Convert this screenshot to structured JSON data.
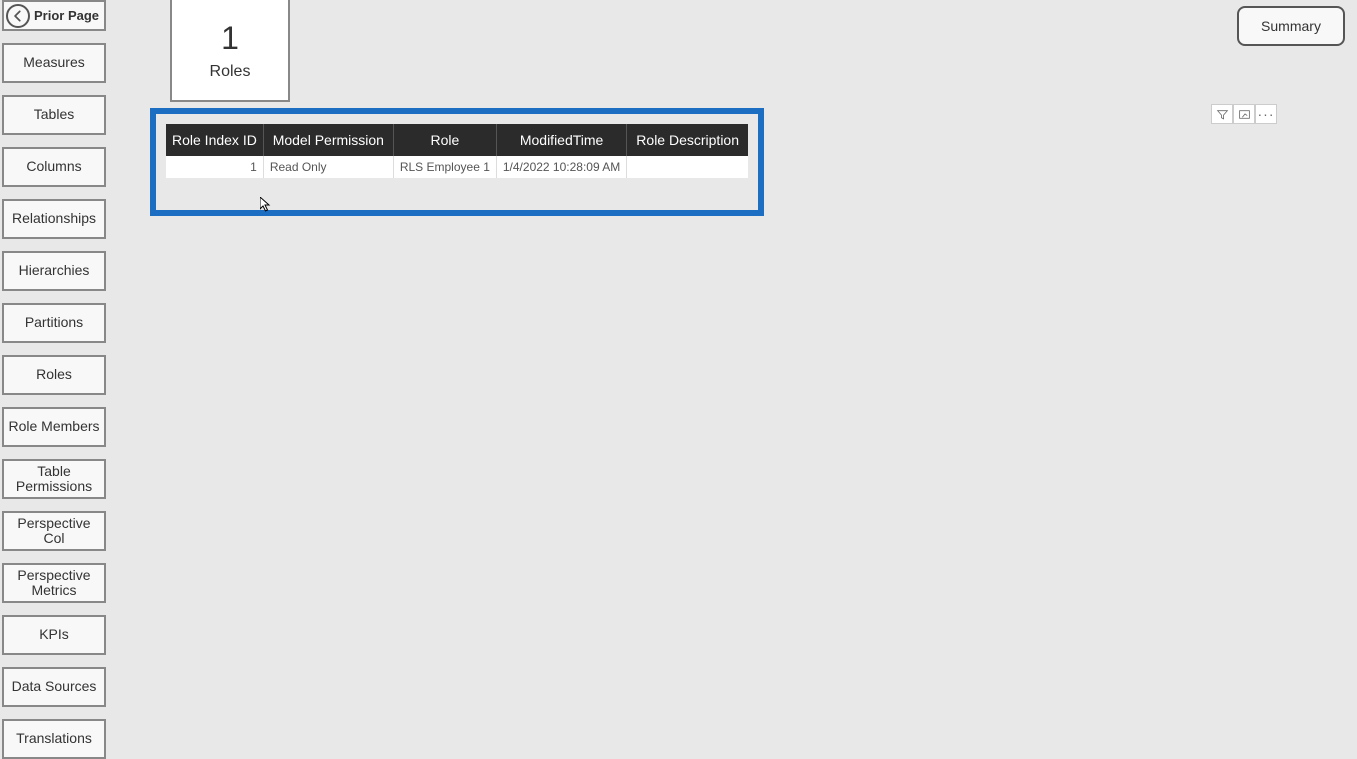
{
  "sidebar": {
    "prior_page": "Prior Page",
    "items": [
      "Measures",
      "Tables",
      "Columns",
      "Relationships",
      "Hierarchies",
      "Partitions",
      "Roles",
      "Role Members",
      "Table Permissions",
      "Perspective Col",
      "Perspective Metrics",
      "KPIs",
      "Data Sources",
      "Translations"
    ]
  },
  "card": {
    "value": "1",
    "label": "Roles"
  },
  "summary_btn": "Summary",
  "toolbar": {
    "filter": "Filter",
    "focus": "Focus mode",
    "more": "More options"
  },
  "table": {
    "headers": [
      "Role Index ID",
      "Model Permission",
      "Role",
      "ModifiedTime",
      "Role Description"
    ],
    "rows": [
      {
        "role_index_id": "1",
        "model_permission": "Read Only",
        "role": "RLS Employee 1",
        "modified_time": "1/4/2022 10:28:09 AM",
        "role_description": ""
      }
    ]
  }
}
